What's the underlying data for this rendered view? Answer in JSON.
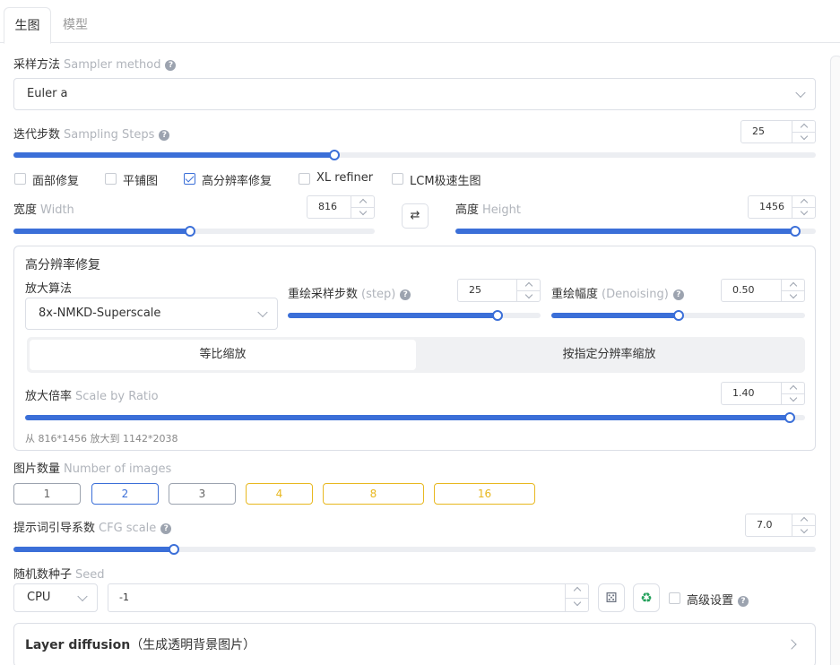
{
  "tabs": [
    "生图",
    "模型"
  ],
  "sampler": {
    "label": "采样方法",
    "label_en": "Sampler method",
    "value": "Euler a"
  },
  "steps": {
    "label": "迭代步数",
    "label_en": "Sampling Steps",
    "value": "25",
    "fraction": 0.4
  },
  "checkboxes": [
    {
      "label": "面部修复",
      "checked": false
    },
    {
      "label": "平铺图",
      "checked": false
    },
    {
      "label": "高分辨率修复",
      "checked": true
    },
    {
      "label": "XL refiner",
      "checked": false
    },
    {
      "label": "LCM极速生图",
      "checked": false
    }
  ],
  "width": {
    "label": "宽度",
    "label_en": "Width",
    "value": "816",
    "fraction": 0.49
  },
  "swap_icon": "swap-arrows-icon",
  "height": {
    "label": "高度",
    "label_en": "Height",
    "value": "1456",
    "fraction": 0.944
  },
  "hires": {
    "title": "高分辨率修复",
    "upscaler": {
      "label": "放大算法",
      "value": "8x-NMKD-Superscale"
    },
    "hr_steps": {
      "label": "重绘采样步数",
      "label_en": "(step)",
      "value": "25",
      "fraction": 0.83
    },
    "denoising": {
      "label": "重绘幅度",
      "label_en": "(Denoising)",
      "value": "0.50",
      "fraction": 0.5
    },
    "mode_tabs": [
      "等比缩放",
      "按指定分辨率缩放"
    ],
    "ratio": {
      "label": "放大倍率",
      "label_en": "Scale by Ratio",
      "value": "1.40",
      "fraction": 0.98
    },
    "info": "从 816*1456 放大到 1142*2038"
  },
  "num_images": {
    "label": "图片数量",
    "label_en": "Number of images",
    "options": [
      "1",
      "2",
      "3",
      "4",
      "8",
      "16"
    ],
    "selected": "2"
  },
  "cfg": {
    "label": "提示词引导系数",
    "label_en": "CFG scale",
    "value": "7.0",
    "fraction": 0.2
  },
  "seed": {
    "label": "随机数种子",
    "label_en": "Seed",
    "device": "CPU",
    "value": "-1",
    "dice_icon": "dice-icon",
    "recycle_icon": "recycle-icon",
    "advanced_label": "高级设置"
  },
  "layer_diffusion": {
    "title": "Layer diffusion",
    "subtitle": "（生成透明背景图片）"
  },
  "colors": {
    "accent": "#3b6fd8",
    "gold": "#e8b820",
    "border": "#dcdfe6"
  }
}
